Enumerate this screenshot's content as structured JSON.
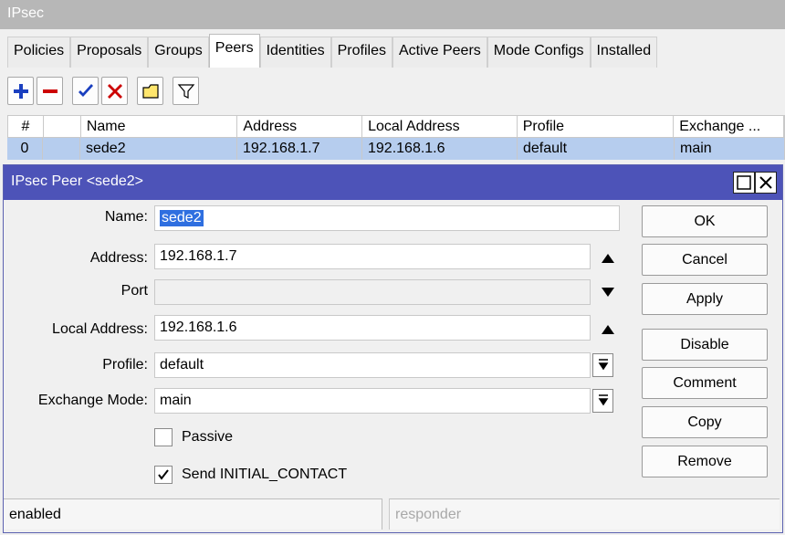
{
  "app": {
    "title": "IPsec"
  },
  "tabs": [
    "Policies",
    "Proposals",
    "Groups",
    "Peers",
    "Identities",
    "Profiles",
    "Active Peers",
    "Mode Configs",
    "Installed"
  ],
  "table": {
    "headers": [
      "#",
      "",
      "Name",
      "Address",
      "Local Address",
      "Profile",
      "Exchange ..."
    ],
    "rows": [
      [
        "0",
        "",
        "sede2",
        "192.168.1.7",
        "192.168.1.6",
        "default",
        "main"
      ]
    ]
  },
  "dialog": {
    "title": "IPsec Peer <sede2>",
    "fields": {
      "name": {
        "label": "Name:",
        "value": "sede2"
      },
      "address": {
        "label": "Address:",
        "value": "192.168.1.7"
      },
      "port": {
        "label": "Port",
        "value": ""
      },
      "local_address": {
        "label": "Local Address:",
        "value": "192.168.1.6"
      },
      "profile": {
        "label": "Profile:",
        "value": "default"
      },
      "exchange_mode": {
        "label": "Exchange Mode:",
        "value": "main"
      }
    },
    "passive": {
      "label": "Passive",
      "checked": false
    },
    "send_initial_contact": {
      "label": "Send INITIAL_CONTACT",
      "checked": true
    },
    "buttons": {
      "ok": "OK",
      "cancel": "Cancel",
      "apply": "Apply",
      "disable": "Disable",
      "comment": "Comment",
      "copy": "Copy",
      "remove": "Remove"
    },
    "status": {
      "left": "enabled",
      "right": "responder"
    }
  },
  "colors": {
    "selection": "#b6cdee",
    "dialog_title": "#4d53b8",
    "add_icon": "#1a3fbf",
    "remove_icon": "#cc0000"
  }
}
